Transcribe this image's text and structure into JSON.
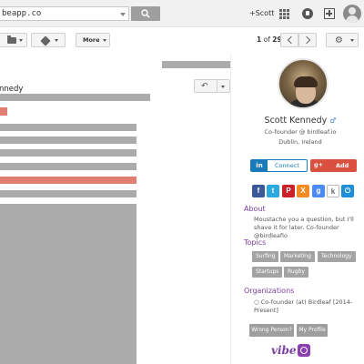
{
  "search": {
    "value": "beapp.co"
  },
  "header": {
    "user_link": "+Scott"
  },
  "toolbar": {
    "more_label": "More",
    "pager_range": "1",
    "pager_of": "of",
    "pager_total": "29"
  },
  "thread": {
    "sender_fragment": "nnedy"
  },
  "profile": {
    "name": "Scott Kennedy",
    "gender_symbol": "♂",
    "title": "Co-founder @ birdleaf.io",
    "location": "Dublin, Ireland",
    "connect_logo": "in",
    "connect_label": "Connect",
    "gplus_logo": "g+",
    "add_label": "Add",
    "social": [
      {
        "name": "facebook-icon",
        "glyph": "f"
      },
      {
        "name": "twitter-icon",
        "glyph": "t"
      },
      {
        "name": "pinterest-icon",
        "glyph": "P"
      },
      {
        "name": "xing-icon",
        "glyph": "X"
      },
      {
        "name": "google-icon",
        "glyph": "g"
      },
      {
        "name": "klout-icon",
        "glyph": "k"
      },
      {
        "name": "power-icon",
        "glyph": "⏻"
      }
    ],
    "about_heading": "About",
    "about_text": "Moustache you a question, but I'll shave it for later. Co-founder @birdleafio",
    "topics_heading": "Topics",
    "topics": [
      "Surfing",
      "Marketing",
      "Technology",
      "Startups",
      "Rugby"
    ],
    "orgs_heading": "Organizations",
    "org_item": "Co-founder (at) Birdleaf [2014-Present]",
    "wrong_person_label": "Wrong Person?",
    "my_profile_label": "My Profile",
    "brand": "vibe"
  },
  "colors": {
    "accent_purple": "#7b3fa0",
    "linkedin_blue": "#1a7bb9",
    "gplus_red": "#d9503f",
    "redacted_gray": "#ababab",
    "highlight_salmon": "#e07e72"
  }
}
